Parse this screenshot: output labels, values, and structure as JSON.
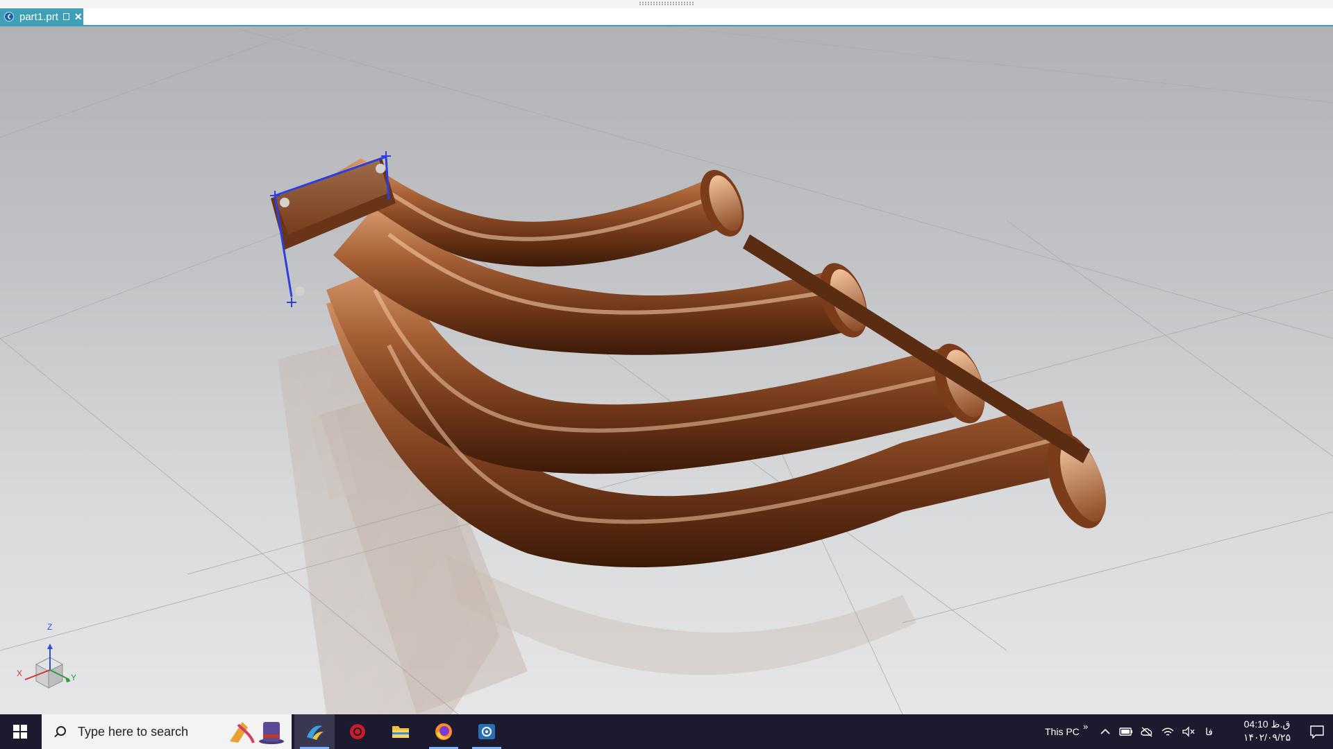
{
  "window": {
    "tab_label": "part1.prt",
    "tab_icon": "nx-part-icon",
    "tab_restore_icon": "restore-icon",
    "tab_close_icon": "close-icon",
    "accent_color": "#3f9fb7"
  },
  "viewport": {
    "model": "exhaust-manifest",
    "model_color": "#9b5a33",
    "triad_labels": {
      "z": "Z",
      "x": "X",
      "y": "Y"
    }
  },
  "taskbar": {
    "search_placeholder": "Type here to search",
    "apps": [
      {
        "name": "solidworks-icon",
        "active": true
      },
      {
        "name": "davinci-icon",
        "active": false
      },
      {
        "name": "file-explorer-icon",
        "active": false
      },
      {
        "name": "firefox-icon",
        "active": true
      },
      {
        "name": "nx-icon",
        "active": true
      }
    ],
    "this_pc_label": "This PC",
    "overflow_icon": "»",
    "language": "فا",
    "clock_time": "04:10 ق.ظ",
    "clock_date": "۱۴۰۲/۰۹/۲۵",
    "background_color": "#1c1a2e"
  }
}
